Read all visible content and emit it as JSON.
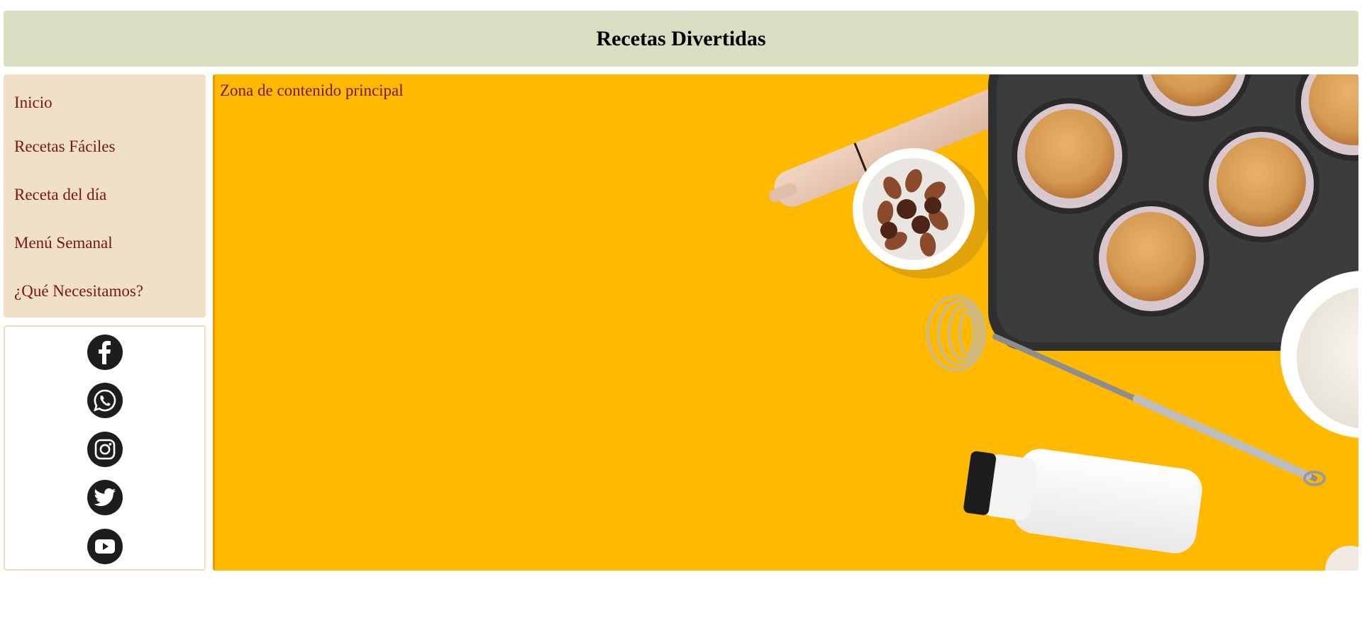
{
  "header": {
    "title": "Recetas Divertidas"
  },
  "nav": {
    "items": [
      {
        "label": "Inicio"
      },
      {
        "label": "Recetas Fáciles"
      },
      {
        "label": "Receta del día"
      },
      {
        "label": "Menú Semanal"
      },
      {
        "label": "¿Qué Necesitamos?"
      }
    ]
  },
  "social": {
    "icons": [
      "facebook-icon",
      "whatsapp-icon",
      "instagram-icon",
      "twitter-icon",
      "youtube-icon"
    ]
  },
  "main": {
    "text": "Zona de contenido principal",
    "background_color": "#ffb900"
  },
  "colors": {
    "header_bg": "#d9ddc1",
    "nav_bg": "#f0e0c8",
    "link_color": "#7b1414",
    "icon_color": "#1d1d1b"
  }
}
